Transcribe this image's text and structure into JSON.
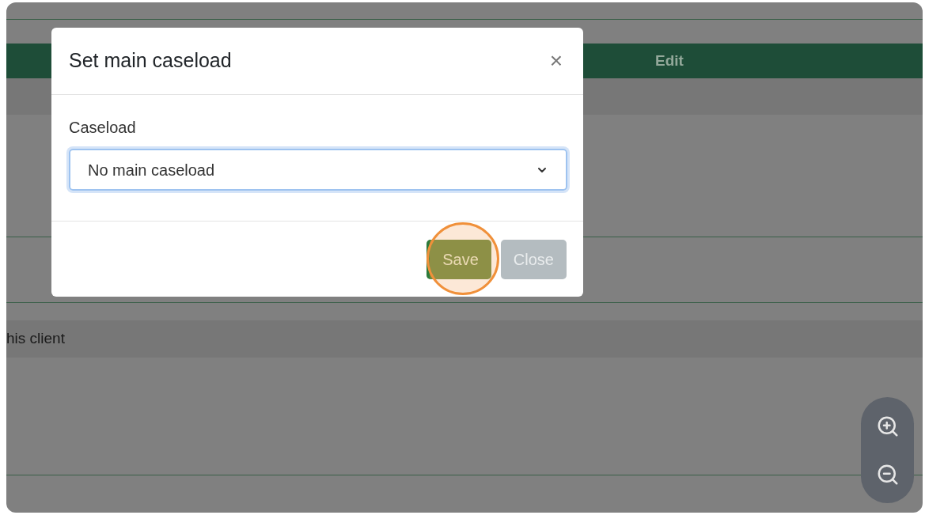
{
  "background_table": {
    "header": {
      "column_2": "Edit"
    },
    "rows": [
      {
        "text": "his client"
      }
    ]
  },
  "dialog": {
    "title": "Set main caseload",
    "close": "×",
    "field": {
      "label": "Caseload",
      "value": "No main caseload"
    },
    "buttons": [
      {
        "label": "Save",
        "kind": "primary"
      },
      {
        "label": "Close",
        "kind": "secondary"
      }
    ]
  }
}
